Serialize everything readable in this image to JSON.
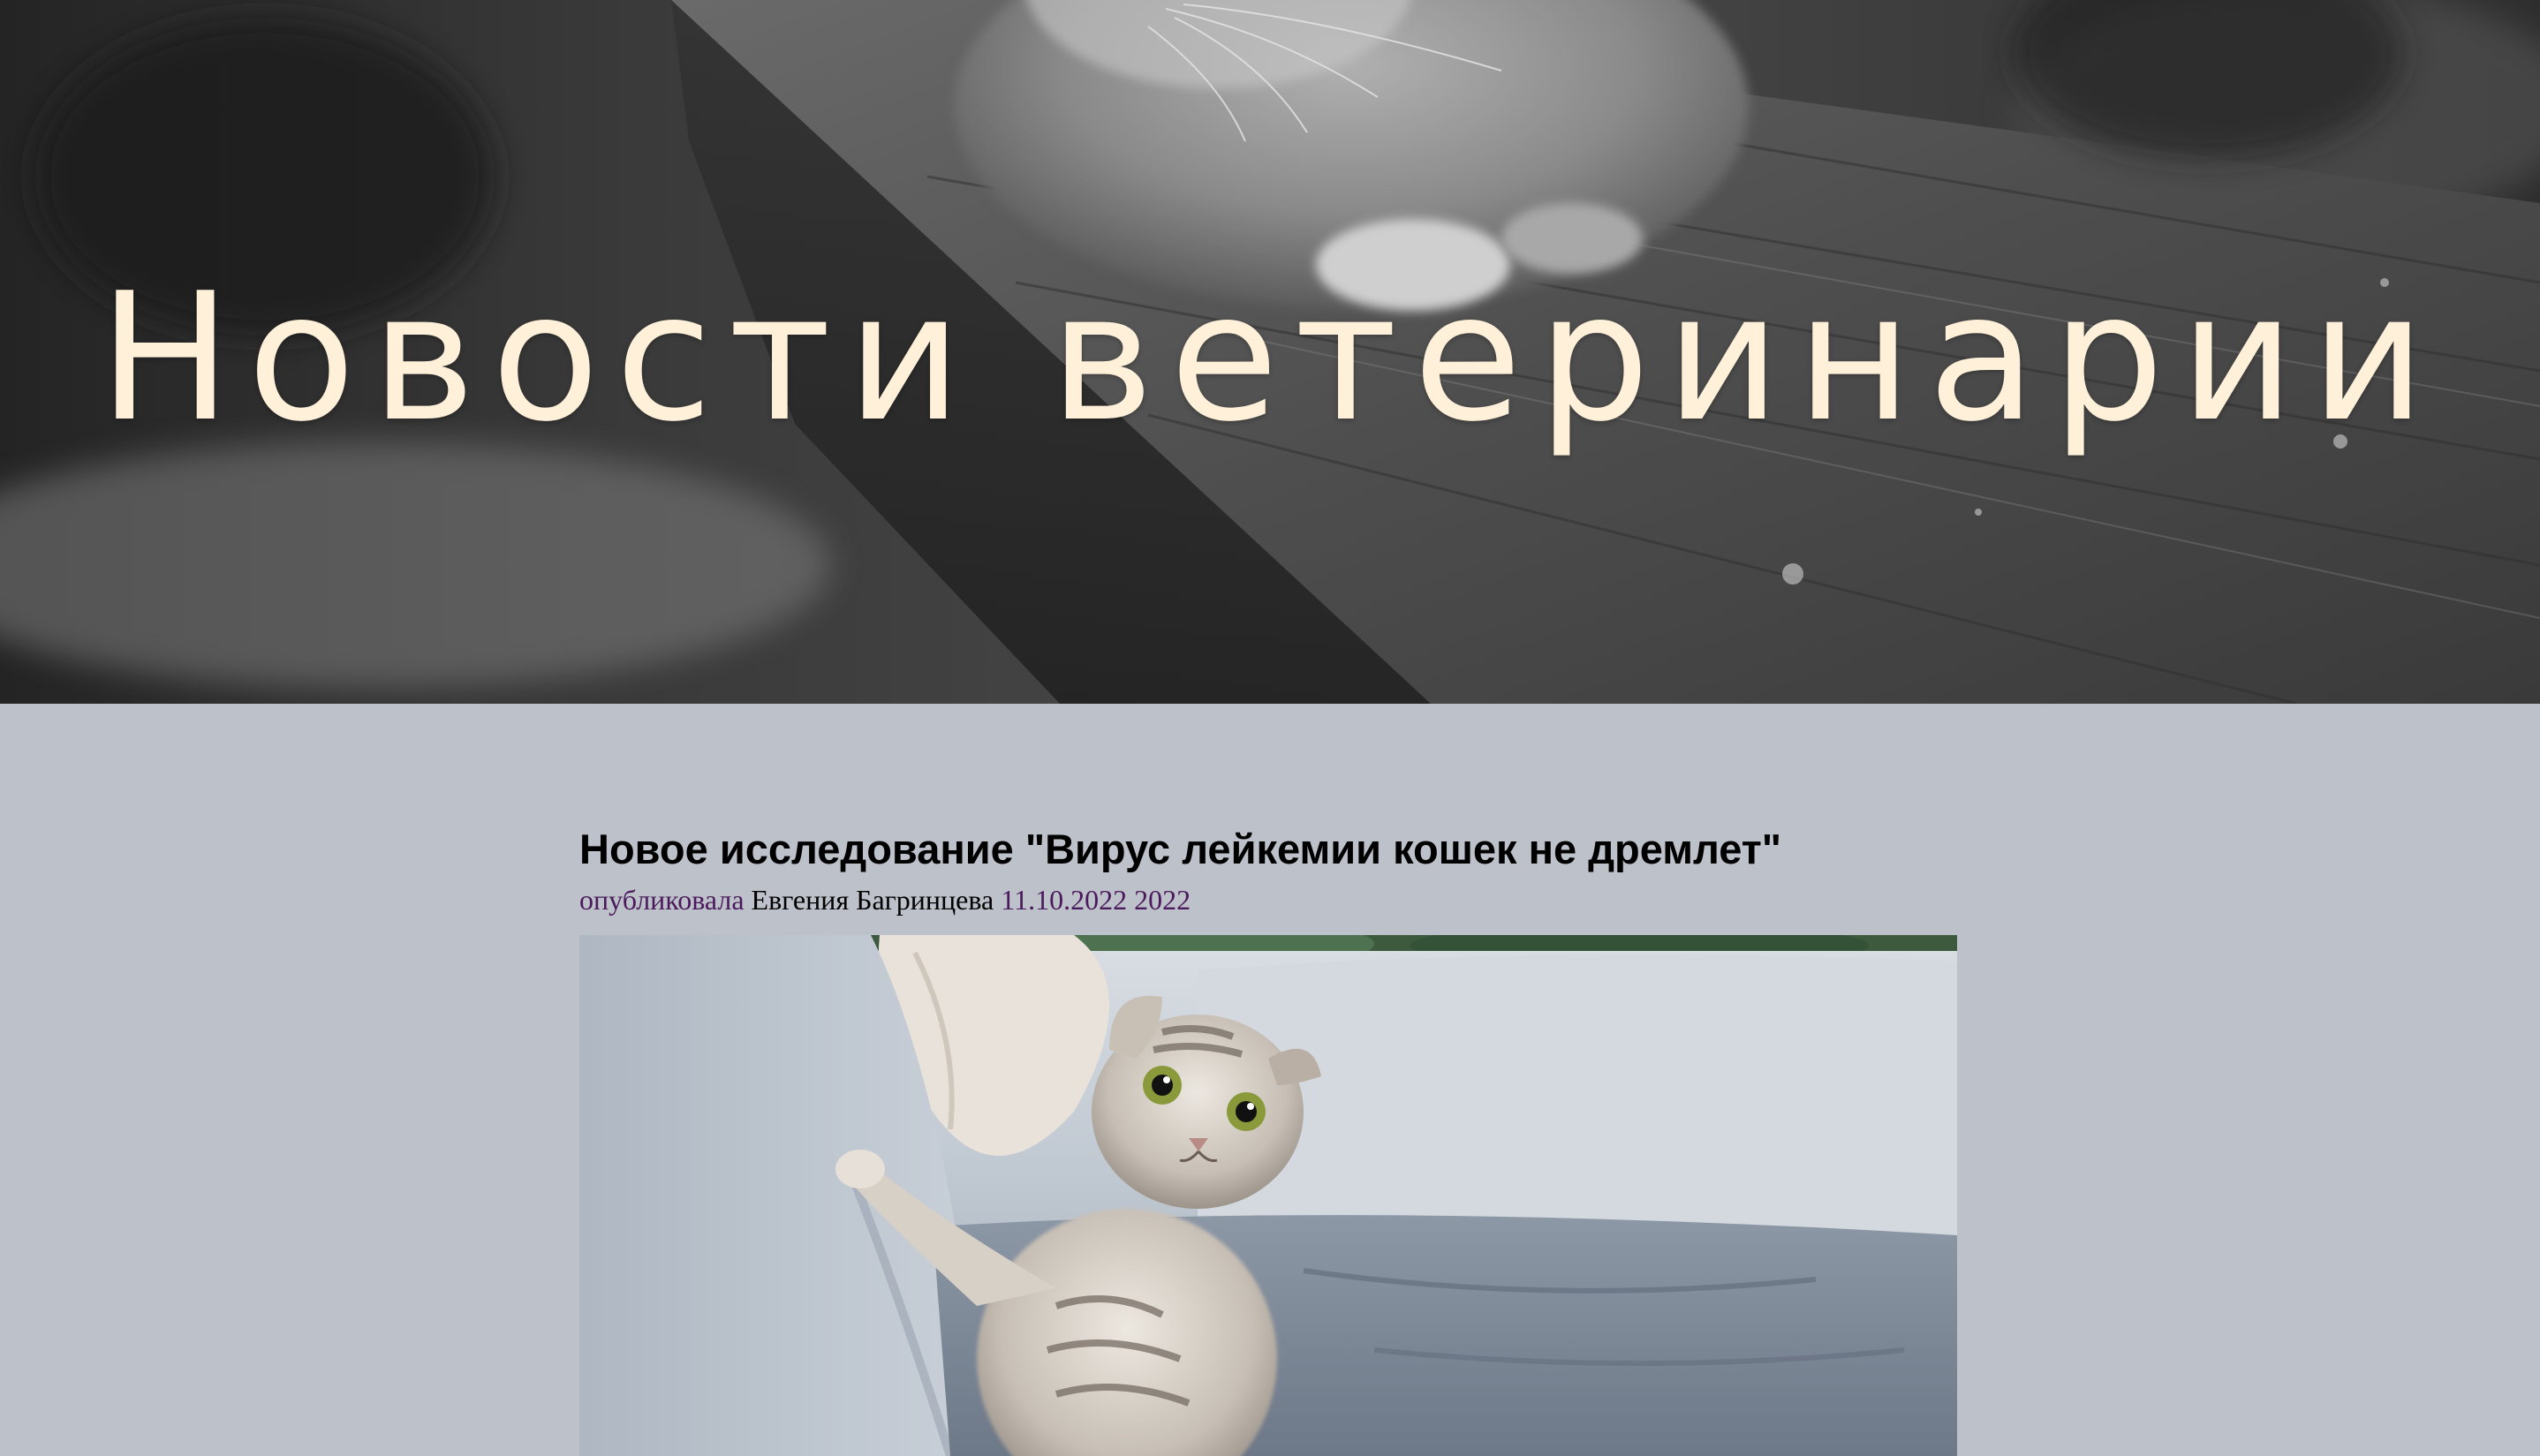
{
  "hero": {
    "title": "Новости ветеринарии",
    "image_alt": "grey cat sitting on wooden railing",
    "title_color": "#fff0d9"
  },
  "article": {
    "title": "Новое исследование \"Вирус лейкемии кошек не дремлет\"",
    "meta": {
      "published_label": "опубликовала",
      "author": "Евгения Багринцева",
      "date": "11.10.2022 2022"
    },
    "image_alt": "tabby kitten on a grey sofa"
  },
  "colors": {
    "page_background": "#bdc1c9",
    "meta_accent": "#4b1a5c"
  }
}
